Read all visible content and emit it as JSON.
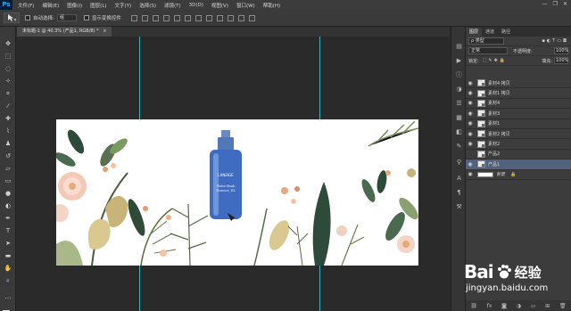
{
  "app": {
    "logo": "Ps"
  },
  "menu": [
    "文件(F)",
    "编辑(E)",
    "图像(I)",
    "图层(L)",
    "文字(Y)",
    "选择(S)",
    "滤镜(T)",
    "3D(D)",
    "视图(V)",
    "窗口(W)",
    "帮助(H)"
  ],
  "window_controls": {
    "minimize": "—",
    "restore": "❐",
    "close": "✕"
  },
  "options_bar": {
    "auto_select_label": "自动选择:",
    "auto_select_value": "组",
    "transform_label": "显示变换控件"
  },
  "document": {
    "tab_title": "未标题-1 @ 40.3% (产品1, RGB/8) *",
    "tab_close": "×",
    "product_brand": "LANEIGE",
    "product_line1": "Water Bank",
    "product_line2": "Essence_EX"
  },
  "colors": {
    "foreground": "#1eb1c7",
    "background": "#111111",
    "guide": "#3fd5e0",
    "selected_layer": "#52617c"
  },
  "layers_panel": {
    "tabs": [
      "图层",
      "通道",
      "路径"
    ],
    "kind_filter": "ρ 类型",
    "blend_mode": "正常",
    "opacity_label": "不透明度:",
    "opacity_value": "100%",
    "lock_label": "锁定:",
    "fill_label": "填充:",
    "fill_value": "100%",
    "layers": [
      {
        "name": "素材4 拷贝",
        "visible": true,
        "selected": false
      },
      {
        "name": "素材1 拷贝",
        "visible": true,
        "selected": false
      },
      {
        "name": "素材4",
        "visible": true,
        "selected": false
      },
      {
        "name": "素材3",
        "visible": true,
        "selected": false
      },
      {
        "name": "素材1",
        "visible": true,
        "selected": false
      },
      {
        "name": "素材2 拷贝",
        "visible": true,
        "selected": false
      },
      {
        "name": "素材2",
        "visible": true,
        "selected": false
      },
      {
        "name": "产品2",
        "visible": false,
        "selected": false
      },
      {
        "name": "产品1",
        "visible": true,
        "selected": true
      },
      {
        "name": "背景",
        "visible": true,
        "selected": false
      }
    ]
  },
  "watermark": {
    "brand": "Bai",
    "brand2": "经验",
    "url": "jingyan.baidu.com"
  }
}
